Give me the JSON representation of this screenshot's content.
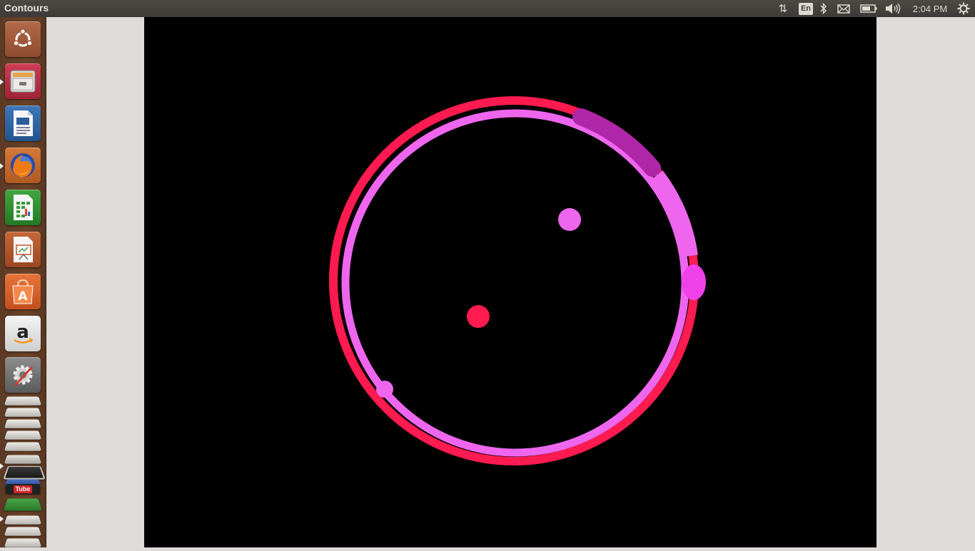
{
  "top_panel": {
    "window_title": "Contours",
    "keyboard_layout": "En",
    "clock": "2:04 PM",
    "icons": [
      "network-updown-icon",
      "keyboard-layout-indicator",
      "bluetooth-icon",
      "mail-icon",
      "battery-icon",
      "volume-icon",
      "session-gear-icon"
    ]
  },
  "launcher": {
    "items": [
      {
        "name": "ubuntu-dash-icon",
        "running": false
      },
      {
        "name": "files-icon",
        "running": true
      },
      {
        "name": "libreoffice-writer-icon",
        "running": false
      },
      {
        "name": "firefox-icon",
        "running": true
      },
      {
        "name": "libreoffice-calc-icon",
        "running": false
      },
      {
        "name": "libreoffice-impress-icon",
        "running": false
      },
      {
        "name": "ubuntu-software-center-icon",
        "running": false
      },
      {
        "name": "amazon-icon",
        "running": false
      },
      {
        "name": "system-settings-icon",
        "running": false
      }
    ],
    "stacked_label": "Tube"
  },
  "canvas": {
    "background": "#000000",
    "colors": {
      "outer_ring": "#ff1a4f",
      "inner_ring": "#ee66ee",
      "arc_highlight": "#b026a8",
      "blob_right": "#f040e8",
      "dot_red": "#ff1a4f",
      "dot_pink": "#ee66ee"
    }
  }
}
